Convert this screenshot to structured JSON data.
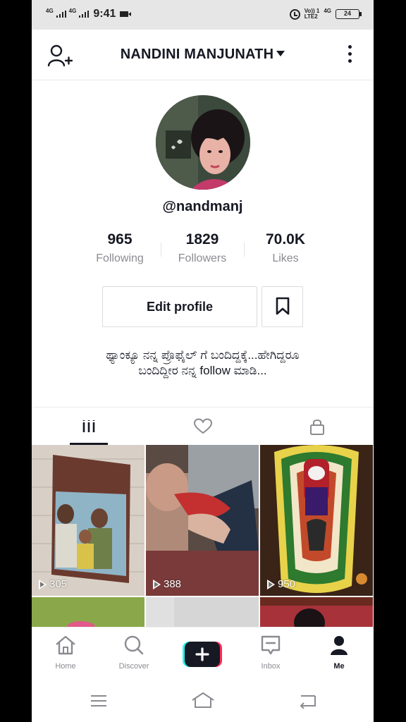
{
  "status_bar": {
    "network_1": "4G",
    "network_2": "4G",
    "time": "9:41",
    "volte": "Vo)) 1",
    "lte": "LTE2",
    "network_3": "4G",
    "battery": "24"
  },
  "header": {
    "username": "NANDINI MANJUNATH"
  },
  "profile": {
    "handle": "@nandmanj",
    "stats": {
      "following": {
        "value": "965",
        "label": "Following"
      },
      "followers": {
        "value": "1829",
        "label": "Followers"
      },
      "likes": {
        "value": "70.0K",
        "label": "Likes"
      }
    },
    "edit_label": "Edit profile",
    "bio_line1": "ಥ್ಯಾಂಕ್ಯೂ ನನ್ನ ಪ್ರೊಫೈಲ್ ಗೆ ಬಂದಿದ್ದಕ್ಕೆ...ಹೇಗಿದ್ದರೂ",
    "bio_line2": "ಬಂದಿದ್ದೀರ ನನ್ನ follow ಮಾಡಿ..."
  },
  "videos": [
    {
      "views": "305"
    },
    {
      "views": "388"
    },
    {
      "views": "950"
    }
  ],
  "bottom_nav": {
    "home": "Home",
    "discover": "Discover",
    "inbox": "Inbox",
    "me": "Me"
  },
  "colors": {
    "text": "#161823",
    "muted": "#8a8b91",
    "create_cyan": "#25f4ee",
    "create_pink": "#fe2c55"
  }
}
